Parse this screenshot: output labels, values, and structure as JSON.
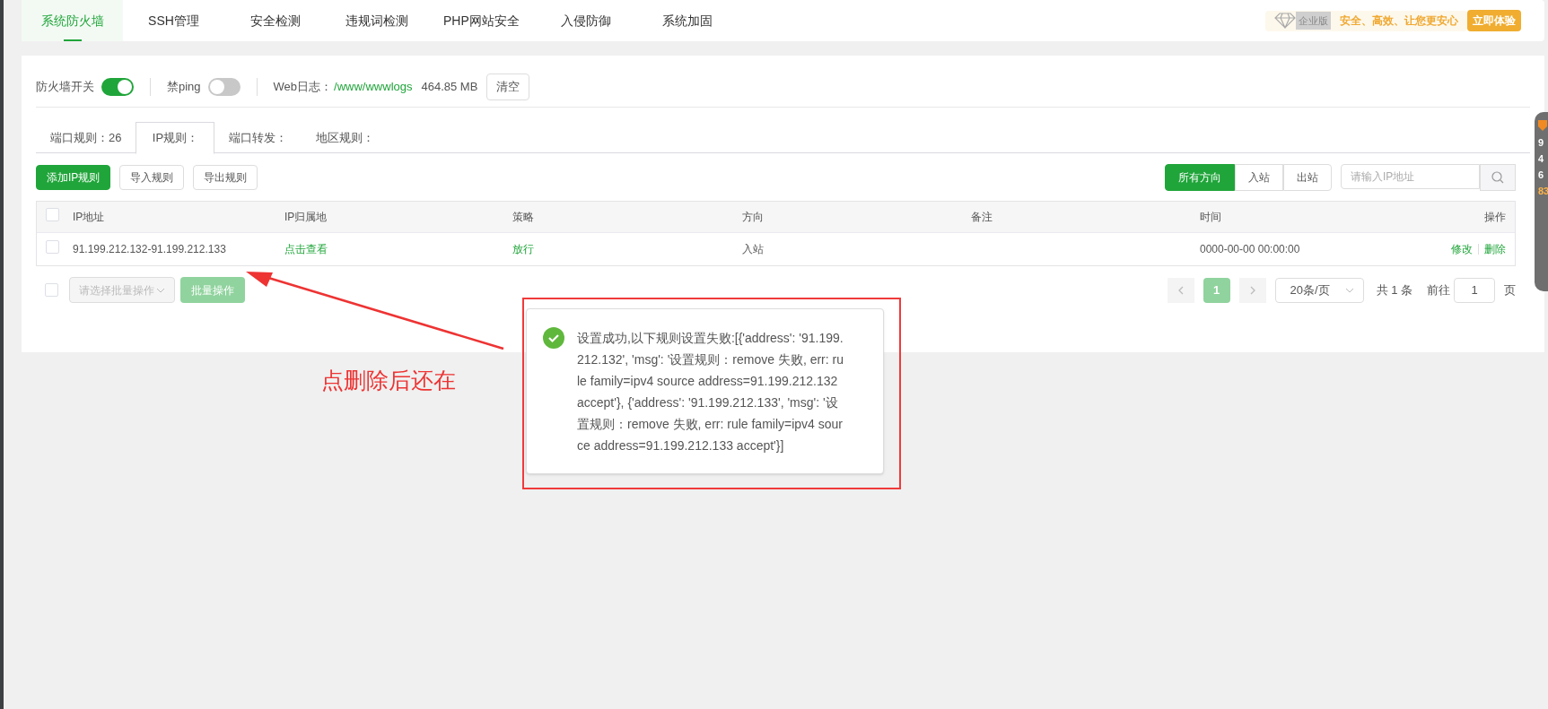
{
  "nav": {
    "tabs": [
      {
        "label": "系统防火墙",
        "selected": true
      },
      {
        "label": "SSH管理",
        "selected": false
      },
      {
        "label": "安全检测",
        "selected": false
      },
      {
        "label": "违规词检测",
        "selected": false
      },
      {
        "label": "PHP网站安全",
        "selected": false
      },
      {
        "label": "入侵防御",
        "selected": false
      },
      {
        "label": "系统加固",
        "selected": false
      }
    ],
    "promo": {
      "badge": "企业版",
      "slogan": "安全、高效、让您更安心",
      "button": "立即体验"
    }
  },
  "toolbar": {
    "switches": [
      {
        "label": "防火墙开关",
        "on": true
      },
      {
        "label": "禁ping",
        "on": false
      }
    ],
    "web_log": {
      "label": "Web日志：",
      "path": "/www/wwwlogs",
      "size": "464.85 MB",
      "button": "清空"
    }
  },
  "rule_tabs": [
    {
      "label": "端口规则：26",
      "selected": false
    },
    {
      "label": "IP规则：",
      "selected": true
    },
    {
      "label": "端口转发：",
      "selected": false
    },
    {
      "label": "地区规则：",
      "selected": false
    }
  ],
  "actions": [
    {
      "label": "添加IP规则",
      "kind": "primary"
    },
    {
      "label": "导入规则",
      "kind": "default"
    },
    {
      "label": "导出规则",
      "kind": "default"
    }
  ],
  "direction_filter": [
    {
      "label": "所有方向",
      "selected": true
    },
    {
      "label": "入站",
      "selected": false
    },
    {
      "label": "出站",
      "selected": false
    }
  ],
  "search": {
    "placeholder": "请输入IP地址"
  },
  "table": {
    "header_checked": false,
    "columns": [
      "IP地址",
      "IP归属地",
      "策略",
      "方向",
      "备注",
      "时间",
      "操作"
    ],
    "rows": [
      {
        "checked": false,
        "ip": "91.199.212.132-91.199.212.133",
        "location": "点击查看",
        "policy": "放行",
        "direction": "入站",
        "time": "0000-00-00 00:00:00",
        "actions": [
          "修改",
          "删除"
        ]
      }
    ]
  },
  "bulk": {
    "checked": false,
    "placeholder": "请选择批量操作",
    "button": "批量操作"
  },
  "pagination": {
    "current": "1",
    "page_size": "20条/页",
    "total": "共 1 条",
    "goto_label": "前往",
    "goto_value": "1",
    "page_suffix": "页"
  },
  "toast": {
    "kind": "success",
    "message": "设置成功,以下规则设置失败:[{'address': '91.199.212.132', 'msg': '设置规则：remove 失败, err: rule family=ipv4 source address=91.199.212.132 accept'}, {'address': '91.199.212.133', 'msg': '设置规则：remove 失败, err: rule family=ipv4 source address=91.199.212.133 accept'}]"
  },
  "annotation": {
    "text": "点删除后还在"
  },
  "side_widget": {
    "texts": [
      "9",
      "4",
      "6",
      "83"
    ]
  }
}
